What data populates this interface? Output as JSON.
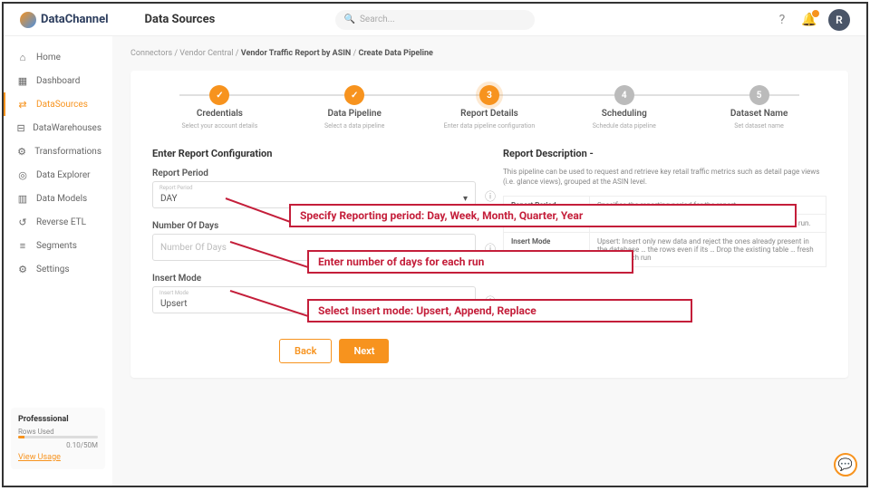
{
  "header": {
    "brand": "DataChannel",
    "title": "Data Sources",
    "search_placeholder": "Search...",
    "avatar": "R"
  },
  "sidebar": {
    "items": [
      {
        "label": "Home",
        "icon": "⌂"
      },
      {
        "label": "Dashboard",
        "icon": "▦"
      },
      {
        "label": "DataSources",
        "icon": "⇄",
        "active": true
      },
      {
        "label": "DataWarehouses",
        "icon": "⊟"
      },
      {
        "label": "Transformations",
        "icon": "⚙"
      },
      {
        "label": "Data Explorer",
        "icon": "◎"
      },
      {
        "label": "Data Models",
        "icon": "▥"
      },
      {
        "label": "Reverse ETL",
        "icon": "↺"
      },
      {
        "label": "Segments",
        "icon": "≡"
      },
      {
        "label": "Settings",
        "icon": "⚙"
      }
    ],
    "plan": {
      "name": "Professsional",
      "rows_label": "Rows Used",
      "rows_value": "0.10/50M",
      "link": "View Usage"
    }
  },
  "breadcrumb": {
    "a": "Connectors",
    "b": "Vendor Central",
    "c": "Vendor Traffic Report by ASIN",
    "d": "Create Data Pipeline"
  },
  "stepper": [
    {
      "label": "Credentials",
      "sub": "Select your account details",
      "state": "done",
      "icon": "✓"
    },
    {
      "label": "Data Pipeline",
      "sub": "Select a data pipeline",
      "state": "done",
      "icon": "✓"
    },
    {
      "label": "Report Details",
      "sub": "Enter data pipeline configuration",
      "state": "active",
      "icon": "3"
    },
    {
      "label": "Scheduling",
      "sub": "Schedule data pipeline",
      "state": "pending",
      "icon": "4"
    },
    {
      "label": "Dataset Name",
      "sub": "Set dataset name",
      "state": "pending",
      "icon": "5"
    }
  ],
  "form": {
    "section_title": "Enter Report Configuration",
    "report_period": {
      "label": "Report Period",
      "tiny": "Report Period",
      "value": "DAY"
    },
    "num_days": {
      "label": "Number Of Days",
      "placeholder": "Number Of Days"
    },
    "insert_mode": {
      "label": "Insert Mode",
      "tiny": "Insert Mode",
      "value": "Upsert"
    }
  },
  "desc": {
    "title": "Report Description -",
    "text": "This pipeline can be used to request and retrieve key retail traffic metrics such as detail page views (i.e. glance views), grouped at the ASIN level.",
    "rows": [
      {
        "k": "Report Period",
        "v": "Specifies the reporting period for the report."
      },
      {
        "k": "",
        "v": "The number of days for which you wish to get the data in each run."
      },
      {
        "k": "Insert Mode",
        "v": "Upsert: Insert only new data and reject the ones already present in the database … the rows even if its … Drop the existing table … fresh data on each run"
      }
    ]
  },
  "buttons": {
    "back": "Back",
    "next": "Next"
  },
  "annotations": {
    "a1": "Specify Reporting period: Day, Week, Month, Quarter, Year",
    "a2": "Enter number of days for each run",
    "a3": "Select Insert mode: Upsert, Append, Replace"
  }
}
